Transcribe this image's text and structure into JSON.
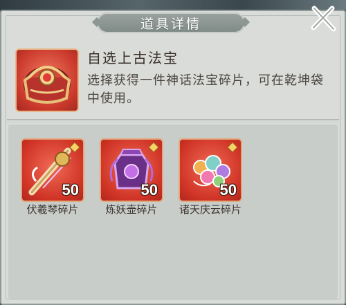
{
  "dialog": {
    "title": "道具详情",
    "close_icon": "close-x-icon"
  },
  "item": {
    "name": "自选上古法宝",
    "description": "选择获得一件神话法宝碎片，可在乾坤袋中使用。",
    "icon": "treasure-chest-icon"
  },
  "rewards": [
    {
      "label": "伏羲琴碎片",
      "count": "50",
      "icon": "fuxi-zither-icon"
    },
    {
      "label": "炼妖壶碎片",
      "count": "50",
      "icon": "demon-refining-pot-icon"
    },
    {
      "label": "诸天庆云碎片",
      "count": "50",
      "icon": "auspicious-cloud-icon"
    }
  ],
  "colors": {
    "panel_bg": "#d9dcd8",
    "item_frame_red": "#cf3325",
    "title_bar": "#8d9793"
  }
}
